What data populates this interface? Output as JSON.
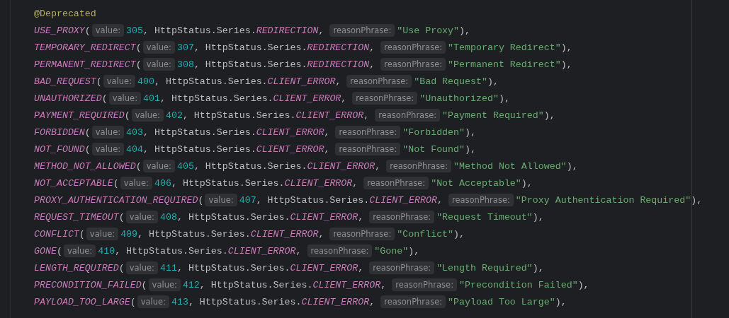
{
  "editor": {
    "lines": [
      {
        "tokens": [
          {
            "kind": "annotation",
            "text": "@Deprecated"
          }
        ]
      },
      {
        "tokens": [
          {
            "kind": "constant",
            "text": "USE_PROXY"
          },
          {
            "kind": "plain",
            "text": "("
          },
          {
            "kind": "hint",
            "text": "value:"
          },
          {
            "kind": "number",
            "text": "305"
          },
          {
            "kind": "plain",
            "text": ", HttpStatus.Series."
          },
          {
            "kind": "enum",
            "text": "REDIRECTION"
          },
          {
            "kind": "plain",
            "text": ","
          },
          {
            "kind": "hint",
            "text": "reasonPhrase:"
          },
          {
            "kind": "string",
            "text": "\"Use Proxy\""
          },
          {
            "kind": "plain",
            "text": "),"
          }
        ]
      },
      {
        "tokens": [
          {
            "kind": "constant",
            "text": "TEMPORARY_REDIRECT"
          },
          {
            "kind": "plain",
            "text": "("
          },
          {
            "kind": "hint",
            "text": "value:"
          },
          {
            "kind": "number",
            "text": "307"
          },
          {
            "kind": "plain",
            "text": ", HttpStatus.Series."
          },
          {
            "kind": "enum",
            "text": "REDIRECTION"
          },
          {
            "kind": "plain",
            "text": ","
          },
          {
            "kind": "hint",
            "text": "reasonPhrase:"
          },
          {
            "kind": "string",
            "text": "\"Temporary Redirect\""
          },
          {
            "kind": "plain",
            "text": "),"
          }
        ]
      },
      {
        "tokens": [
          {
            "kind": "constant",
            "text": "PERMANENT_REDIRECT"
          },
          {
            "kind": "plain",
            "text": "("
          },
          {
            "kind": "hint",
            "text": "value:"
          },
          {
            "kind": "number",
            "text": "308"
          },
          {
            "kind": "plain",
            "text": ", HttpStatus.Series."
          },
          {
            "kind": "enum",
            "text": "REDIRECTION"
          },
          {
            "kind": "plain",
            "text": ","
          },
          {
            "kind": "hint",
            "text": "reasonPhrase:"
          },
          {
            "kind": "string",
            "text": "\"Permanent Redirect\""
          },
          {
            "kind": "plain",
            "text": "),"
          }
        ]
      },
      {
        "tokens": [
          {
            "kind": "constant",
            "text": "BAD_REQUEST"
          },
          {
            "kind": "plain",
            "text": "("
          },
          {
            "kind": "hint",
            "text": "value:"
          },
          {
            "kind": "number",
            "text": "400"
          },
          {
            "kind": "plain",
            "text": ", HttpStatus.Series."
          },
          {
            "kind": "enum",
            "text": "CLIENT_ERROR"
          },
          {
            "kind": "plain",
            "text": ","
          },
          {
            "kind": "hint",
            "text": "reasonPhrase:"
          },
          {
            "kind": "string",
            "text": "\"Bad Request\""
          },
          {
            "kind": "plain",
            "text": "),"
          }
        ]
      },
      {
        "tokens": [
          {
            "kind": "constant",
            "text": "UNAUTHORIZED"
          },
          {
            "kind": "plain",
            "text": "("
          },
          {
            "kind": "hint",
            "text": "value:"
          },
          {
            "kind": "number",
            "text": "401"
          },
          {
            "kind": "plain",
            "text": ", HttpStatus.Series."
          },
          {
            "kind": "enum",
            "text": "CLIENT_ERROR"
          },
          {
            "kind": "plain",
            "text": ","
          },
          {
            "kind": "hint",
            "text": "reasonPhrase:"
          },
          {
            "kind": "string",
            "text": "\"Unauthorized\""
          },
          {
            "kind": "plain",
            "text": "),"
          }
        ]
      },
      {
        "tokens": [
          {
            "kind": "constant",
            "text": "PAYMENT_REQUIRED"
          },
          {
            "kind": "plain",
            "text": "("
          },
          {
            "kind": "hint",
            "text": "value:"
          },
          {
            "kind": "number",
            "text": "402"
          },
          {
            "kind": "plain",
            "text": ", HttpStatus.Series."
          },
          {
            "kind": "enum",
            "text": "CLIENT_ERROR"
          },
          {
            "kind": "plain",
            "text": ","
          },
          {
            "kind": "hint",
            "text": "reasonPhrase:"
          },
          {
            "kind": "string",
            "text": "\"Payment Required\""
          },
          {
            "kind": "plain",
            "text": "),"
          }
        ]
      },
      {
        "tokens": [
          {
            "kind": "constant",
            "text": "FORBIDDEN"
          },
          {
            "kind": "plain",
            "text": "("
          },
          {
            "kind": "hint",
            "text": "value:"
          },
          {
            "kind": "number",
            "text": "403"
          },
          {
            "kind": "plain",
            "text": ", HttpStatus.Series."
          },
          {
            "kind": "enum",
            "text": "CLIENT_ERROR"
          },
          {
            "kind": "plain",
            "text": ","
          },
          {
            "kind": "hint",
            "text": "reasonPhrase:"
          },
          {
            "kind": "string",
            "text": "\"Forbidden\""
          },
          {
            "kind": "plain",
            "text": "),"
          }
        ]
      },
      {
        "tokens": [
          {
            "kind": "constant",
            "text": "NOT_FOUND"
          },
          {
            "kind": "plain",
            "text": "("
          },
          {
            "kind": "hint",
            "text": "value:"
          },
          {
            "kind": "number",
            "text": "404"
          },
          {
            "kind": "plain",
            "text": ", HttpStatus.Series."
          },
          {
            "kind": "enum",
            "text": "CLIENT_ERROR"
          },
          {
            "kind": "plain",
            "text": ","
          },
          {
            "kind": "hint",
            "text": "reasonPhrase:"
          },
          {
            "kind": "string",
            "text": "\"Not Found\""
          },
          {
            "kind": "plain",
            "text": "),"
          }
        ]
      },
      {
        "tokens": [
          {
            "kind": "constant",
            "text": "METHOD_NOT_ALLOWED"
          },
          {
            "kind": "plain",
            "text": "("
          },
          {
            "kind": "hint",
            "text": "value:"
          },
          {
            "kind": "number",
            "text": "405"
          },
          {
            "kind": "plain",
            "text": ", HttpStatus.Series."
          },
          {
            "kind": "enum",
            "text": "CLIENT_ERROR"
          },
          {
            "kind": "plain",
            "text": ","
          },
          {
            "kind": "hint",
            "text": "reasonPhrase:"
          },
          {
            "kind": "string",
            "text": "\"Method Not Allowed\""
          },
          {
            "kind": "plain",
            "text": "),"
          }
        ]
      },
      {
        "tokens": [
          {
            "kind": "constant",
            "text": "NOT_ACCEPTABLE"
          },
          {
            "kind": "plain",
            "text": "("
          },
          {
            "kind": "hint",
            "text": "value:"
          },
          {
            "kind": "number",
            "text": "406"
          },
          {
            "kind": "plain",
            "text": ", HttpStatus.Series."
          },
          {
            "kind": "enum",
            "text": "CLIENT_ERROR"
          },
          {
            "kind": "plain",
            "text": ","
          },
          {
            "kind": "hint",
            "text": "reasonPhrase:"
          },
          {
            "kind": "string",
            "text": "\"Not Acceptable\""
          },
          {
            "kind": "plain",
            "text": "),"
          }
        ]
      },
      {
        "tokens": [
          {
            "kind": "constant",
            "text": "PROXY_AUTHENTICATION_REQUIRED"
          },
          {
            "kind": "plain",
            "text": "("
          },
          {
            "kind": "hint",
            "text": "value:"
          },
          {
            "kind": "number",
            "text": "407"
          },
          {
            "kind": "plain",
            "text": ", HttpStatus.Series."
          },
          {
            "kind": "enum",
            "text": "CLIENT_ERROR"
          },
          {
            "kind": "plain",
            "text": ","
          },
          {
            "kind": "hint",
            "text": "reasonPhrase:"
          },
          {
            "kind": "string",
            "text": "\"Proxy Authentication Required\""
          },
          {
            "kind": "plain",
            "text": "),"
          }
        ]
      },
      {
        "tokens": [
          {
            "kind": "constant",
            "text": "REQUEST_TIMEOUT"
          },
          {
            "kind": "plain",
            "text": "("
          },
          {
            "kind": "hint",
            "text": "value:"
          },
          {
            "kind": "number",
            "text": "408"
          },
          {
            "kind": "plain",
            "text": ", HttpStatus.Series."
          },
          {
            "kind": "enum",
            "text": "CLIENT_ERROR"
          },
          {
            "kind": "plain",
            "text": ","
          },
          {
            "kind": "hint",
            "text": "reasonPhrase:"
          },
          {
            "kind": "string",
            "text": "\"Request Timeout\""
          },
          {
            "kind": "plain",
            "text": "),"
          }
        ]
      },
      {
        "tokens": [
          {
            "kind": "constant",
            "text": "CONFLICT"
          },
          {
            "kind": "plain",
            "text": "("
          },
          {
            "kind": "hint",
            "text": "value:"
          },
          {
            "kind": "number",
            "text": "409"
          },
          {
            "kind": "plain",
            "text": ", HttpStatus.Series."
          },
          {
            "kind": "enum",
            "text": "CLIENT_ERROR"
          },
          {
            "kind": "plain",
            "text": ","
          },
          {
            "kind": "hint",
            "text": "reasonPhrase:"
          },
          {
            "kind": "string",
            "text": "\"Conflict\""
          },
          {
            "kind": "plain",
            "text": "),"
          }
        ]
      },
      {
        "tokens": [
          {
            "kind": "constant",
            "text": "GONE"
          },
          {
            "kind": "plain",
            "text": "("
          },
          {
            "kind": "hint",
            "text": "value:"
          },
          {
            "kind": "number",
            "text": "410"
          },
          {
            "kind": "plain",
            "text": ", HttpStatus.Series."
          },
          {
            "kind": "enum",
            "text": "CLIENT_ERROR"
          },
          {
            "kind": "plain",
            "text": ","
          },
          {
            "kind": "hint",
            "text": "reasonPhrase:"
          },
          {
            "kind": "string",
            "text": "\"Gone\""
          },
          {
            "kind": "plain",
            "text": "),"
          }
        ]
      },
      {
        "tokens": [
          {
            "kind": "constant",
            "text": "LENGTH_REQUIRED"
          },
          {
            "kind": "plain",
            "text": "("
          },
          {
            "kind": "hint",
            "text": "value:"
          },
          {
            "kind": "number",
            "text": "411"
          },
          {
            "kind": "plain",
            "text": ", HttpStatus.Series."
          },
          {
            "kind": "enum",
            "text": "CLIENT_ERROR"
          },
          {
            "kind": "plain",
            "text": ","
          },
          {
            "kind": "hint",
            "text": "reasonPhrase:"
          },
          {
            "kind": "string",
            "text": "\"Length Required\""
          },
          {
            "kind": "plain",
            "text": "),"
          }
        ]
      },
      {
        "tokens": [
          {
            "kind": "constant",
            "text": "PRECONDITION_FAILED"
          },
          {
            "kind": "plain",
            "text": "("
          },
          {
            "kind": "hint",
            "text": "value:"
          },
          {
            "kind": "number",
            "text": "412"
          },
          {
            "kind": "plain",
            "text": ", HttpStatus.Series."
          },
          {
            "kind": "enum",
            "text": "CLIENT_ERROR"
          },
          {
            "kind": "plain",
            "text": ","
          },
          {
            "kind": "hint",
            "text": "reasonPhrase:"
          },
          {
            "kind": "string",
            "text": "\"Precondition Failed\""
          },
          {
            "kind": "plain",
            "text": "),"
          }
        ]
      },
      {
        "tokens": [
          {
            "kind": "constant",
            "text": "PAYLOAD_TOO_LARGE"
          },
          {
            "kind": "plain",
            "text": "("
          },
          {
            "kind": "hint",
            "text": "value:"
          },
          {
            "kind": "number",
            "text": "413"
          },
          {
            "kind": "plain",
            "text": ", HttpStatus.Series."
          },
          {
            "kind": "enum",
            "text": "CLIENT_ERROR"
          },
          {
            "kind": "plain",
            "text": ","
          },
          {
            "kind": "hint",
            "text": "reasonPhrase:"
          },
          {
            "kind": "string",
            "text": "\"Payload Too Large\""
          },
          {
            "kind": "plain",
            "text": "),"
          }
        ]
      }
    ]
  }
}
